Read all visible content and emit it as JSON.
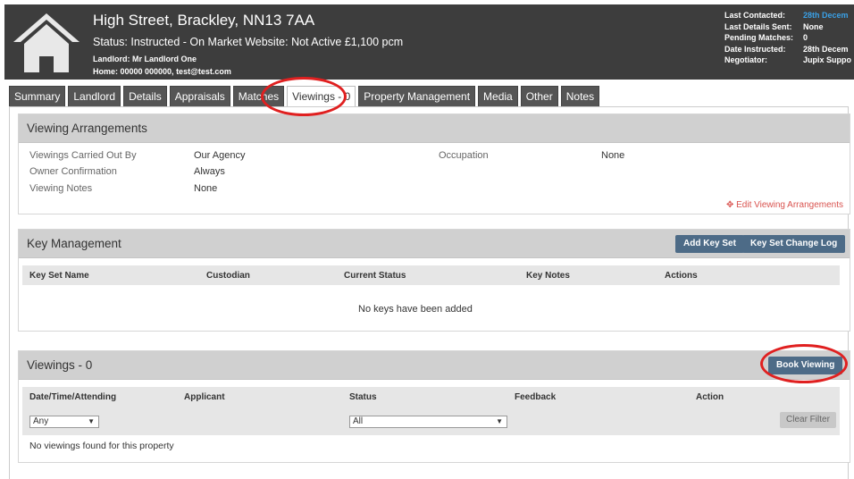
{
  "header": {
    "address": "High Street, Brackley, NN13 7AA",
    "status_line": "Status: Instructed - On Market  Website: Not Active  £1,100 pcm",
    "landlord": "Landlord: Mr Landlord One",
    "contact": "Home: 00000 000000, test@test.com",
    "meta": [
      {
        "label": "Last Contacted:",
        "value": "28th Decem"
      },
      {
        "label": "Last Details Sent:",
        "value": "None"
      },
      {
        "label": "Pending Matches:",
        "value": "0"
      },
      {
        "label": "Date Instructed:",
        "value": "28th Decem"
      },
      {
        "label": "Negotiator:",
        "value": "Jupix Suppo"
      }
    ],
    "link_color": "#3aa0e6",
    "icon": "house-icon"
  },
  "tabs": [
    {
      "label": "Summary"
    },
    {
      "label": "Landlord"
    },
    {
      "label": "Details"
    },
    {
      "label": "Appraisals"
    },
    {
      "label": "Matches"
    },
    {
      "label": "Viewings - 0",
      "active": true
    },
    {
      "label": "Property Management"
    },
    {
      "label": "Media"
    },
    {
      "label": "Other"
    },
    {
      "label": "Notes"
    }
  ],
  "viewing_arrangements": {
    "title": "Viewing Arrangements",
    "carried_out_by_label": "Viewings Carried Out By",
    "carried_out_by_value": "Our Agency",
    "owner_confirmation_label": "Owner Confirmation",
    "owner_confirmation_value": "Always",
    "notes_label": "Viewing Notes",
    "notes_value": "None",
    "occupation_label": "Occupation",
    "occupation_value": "None",
    "edit_link": "Edit Viewing Arrangements",
    "edit_icon": "move-icon"
  },
  "key_management": {
    "title": "Key Management",
    "add_button": "Add Key Set",
    "log_button": "Key Set Change Log",
    "columns": [
      "Key Set Name",
      "Custodian",
      "Current Status",
      "Key Notes",
      "Actions"
    ],
    "empty_text": "No keys have been added"
  },
  "viewings": {
    "title": "Viewings - 0",
    "book_button": "Book Viewing",
    "columns": [
      "Date/Time/Attending",
      "Applicant",
      "Status",
      "Feedback",
      "Action"
    ],
    "date_filter": "Any",
    "status_filter": "All",
    "clear_button": "Clear Filter",
    "empty_text": "No viewings found for this property"
  },
  "colors": {
    "header_bg": "#3d3d3d",
    "tab_bg": "#555555",
    "button": "#4d6b87",
    "annotation": "#e02020",
    "edit_link": "#d9534f"
  }
}
